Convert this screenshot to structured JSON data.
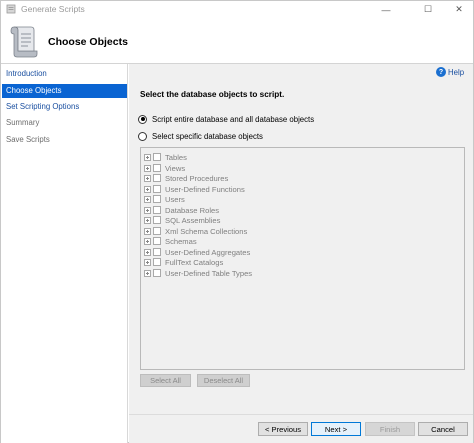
{
  "window": {
    "title": "Generate Scripts",
    "controls": {
      "minimize": "—",
      "maximize": "☐",
      "close": "✕"
    }
  },
  "header": {
    "title": "Choose Objects",
    "icon": "script-scroll-icon"
  },
  "nav": {
    "items": [
      {
        "label": "Introduction",
        "state": "link"
      },
      {
        "label": "Choose Objects",
        "state": "active"
      },
      {
        "label": "Set Scripting Options",
        "state": "link"
      },
      {
        "label": "Summary",
        "state": "disabled"
      },
      {
        "label": "Save Scripts",
        "state": "disabled"
      }
    ]
  },
  "help": {
    "label": "Help",
    "icon": "question"
  },
  "prompt": "Select the database objects to script.",
  "options": {
    "entire": {
      "label": "Script entire database and all database objects",
      "checked": true
    },
    "specific": {
      "label": "Select specific database objects",
      "checked": false
    }
  },
  "tree": {
    "items": [
      "Tables",
      "Views",
      "Stored Procedures",
      "User-Defined Functions",
      "Users",
      "Database Roles",
      "SQL Assemblies",
      "Xml Schema Collections",
      "Schemas",
      "User-Defined Aggregates",
      "FullText Catalogs",
      "User-Defined Table Types"
    ]
  },
  "selection_buttons": {
    "select_all": "Select All",
    "deselect_all": "Deselect All"
  },
  "footer": {
    "previous": "< Previous",
    "next": "Next >",
    "finish": "Finish",
    "cancel": "Cancel"
  },
  "colors": {
    "accent": "#0a64d2",
    "link": "#1a4fa0",
    "content_bg": "#f0f0f0"
  }
}
